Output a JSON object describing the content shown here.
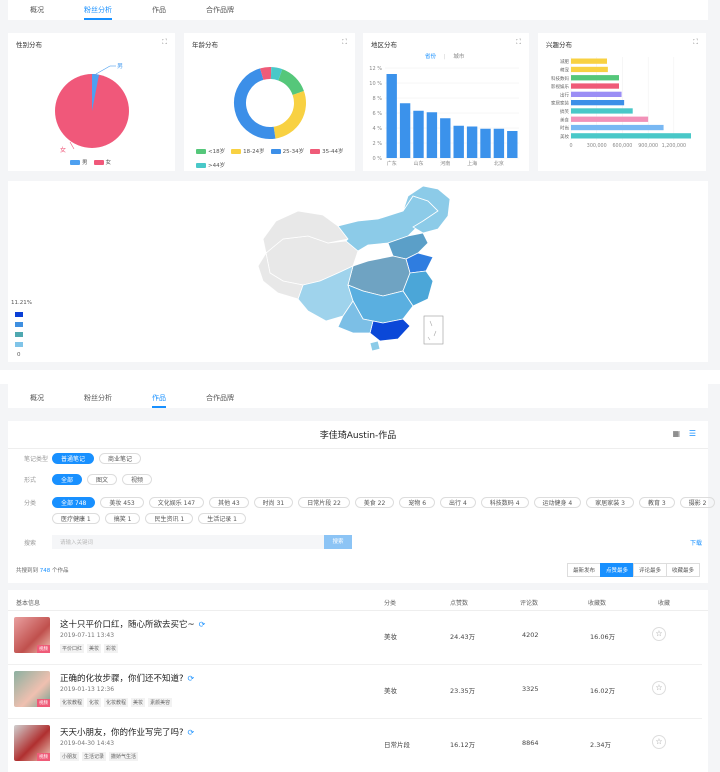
{
  "top_tabs": [
    "概况",
    "粉丝分析",
    "作品",
    "合作品牌"
  ],
  "top_active": 1,
  "charts": {
    "gender": {
      "title": "性别分布",
      "legend": [
        "男",
        "女"
      ],
      "label_male": "男",
      "label_female": "女"
    },
    "age": {
      "title": "年龄分布",
      "legend": [
        "<18岁",
        "18-24岁",
        "25-34岁",
        "35-44岁",
        ">44岁"
      ]
    },
    "region": {
      "title": "地区分布",
      "toggle": [
        "省份",
        "城市"
      ]
    },
    "interest": {
      "title": "兴趣分布"
    }
  },
  "chart_data": [
    {
      "type": "pie",
      "title": "性别分布",
      "categories": [
        "男",
        "女"
      ],
      "values": [
        3,
        97
      ],
      "colors": [
        "#4ea0f0",
        "#f0587a"
      ]
    },
    {
      "type": "pie",
      "title": "年龄分布",
      "categories": [
        "<18岁",
        "18-24岁",
        "25-34岁",
        "35-44岁",
        ">44岁"
      ],
      "values": [
        14,
        28,
        48,
        5,
        5
      ],
      "colors": [
        "#55c77a",
        "#f8d142",
        "#3c8fe8",
        "#ef5b78",
        "#49c8c8"
      ]
    },
    {
      "type": "bar",
      "title": "地区分布",
      "categories": [
        "广东",
        "",
        "山东",
        "",
        "河南",
        "",
        "上海",
        "",
        "北京",
        ""
      ],
      "values": [
        11.2,
        7.3,
        6.3,
        6.1,
        5.3,
        4.3,
        4.2,
        3.9,
        3.9,
        3.6
      ],
      "yticks": [
        "0 %",
        "2 %",
        "4 %",
        "6 %",
        "8 %",
        "10 %",
        "12 %"
      ],
      "ylim": [
        0,
        12
      ],
      "color": "#3b92eb"
    },
    {
      "type": "bar",
      "title": "兴趣分布",
      "orientation": "horizontal",
      "categories": [
        "减肥",
        "萌宠",
        "科技数码",
        "影视娱乐",
        "出行",
        "家居家装",
        "搞笑",
        "美食",
        "时尚",
        "美妆"
      ],
      "values": [
        420000,
        430000,
        560000,
        560000,
        590000,
        620000,
        720000,
        900000,
        1080000,
        1450000
      ],
      "xticks": [
        "0",
        "300,000",
        "600,000",
        "900,000",
        "1,200,000"
      ],
      "xlim": [
        0,
        1400000
      ],
      "colors": [
        "#f8d142",
        "#f8d142",
        "#55c77a",
        "#ef5b78",
        "#9b8ef5",
        "#3c8fe8",
        "#49c8c8",
        "#f291b8",
        "#79b8f3",
        "#49c8c8"
      ]
    }
  ],
  "map": {
    "legend_max": "11.21%",
    "legend_min": "0",
    "legend_colors": [
      "#0a3fd6",
      "#3f8fe0",
      "#4fa8b0",
      "#80c4e8"
    ]
  },
  "bottom_tabs": [
    "概况",
    "粉丝分析",
    "作品",
    "合作品牌"
  ],
  "bottom_active": 2,
  "works_title": "李佳琦Austin-作品",
  "filters": {
    "type_label": "笔记类型",
    "types": [
      "普通笔记",
      "商业笔记"
    ],
    "form_label": "形式",
    "forms": [
      "全部",
      "图文",
      "视频"
    ],
    "cat_label": "分类",
    "cats_row1": [
      "全部 748",
      "美妆 453",
      "文化娱乐 147",
      "其他 43",
      "时尚 31",
      "日常片段 22",
      "美食 22",
      "宠物 6",
      "出行 4",
      "科技数码 4",
      "运动健身 4",
      "家居家装 3",
      "教育 3",
      "摄影 2"
    ],
    "cats_row2": [
      "医疗健康 1",
      "搞笑 1",
      "民生资讯 1",
      "生活记录 1"
    ],
    "search_label": "搜索",
    "search_placeholder": "请输入关键词",
    "search_button": "搜索",
    "download": "下载"
  },
  "summary": {
    "prefix": "共搜到到",
    "count": "748",
    "suffix": "个作品"
  },
  "sort_buttons": [
    "最新发布",
    "点赞最多",
    "评论最多",
    "收藏最多"
  ],
  "table": {
    "headers": [
      "基本信息",
      "分类",
      "点赞数",
      "评论数",
      "收藏数",
      "收藏"
    ],
    "rows": [
      {
        "title": "这十只平价口红，随心所欲去买它~",
        "date": "2019-07-11 13:43",
        "tags": [
          "平价口红",
          "美妆",
          "彩妆"
        ],
        "category": "美妆",
        "likes": "24.43万",
        "comments": "4202",
        "favorites": "16.06万",
        "thumb_tag": "视频"
      },
      {
        "title": "正确的化妆步骤，你们还不知道?",
        "date": "2019-01-13 12:36",
        "tags": [
          "化妆教程",
          "化妆",
          "化妆教程",
          "美妆",
          "素颜美容"
        ],
        "category": "美妆",
        "likes": "23.35万",
        "comments": "3325",
        "favorites": "16.02万",
        "thumb_tag": "视频"
      },
      {
        "title": "天天小朋友，你的作业写完了吗?",
        "date": "2019-04-30 14:43",
        "tags": [
          "小朋友",
          "生活记录",
          "撒娇气生活"
        ],
        "category": "日常片段",
        "likes": "16.12万",
        "comments": "8864",
        "favorites": "2.34万",
        "thumb_tag": "视频"
      }
    ]
  }
}
